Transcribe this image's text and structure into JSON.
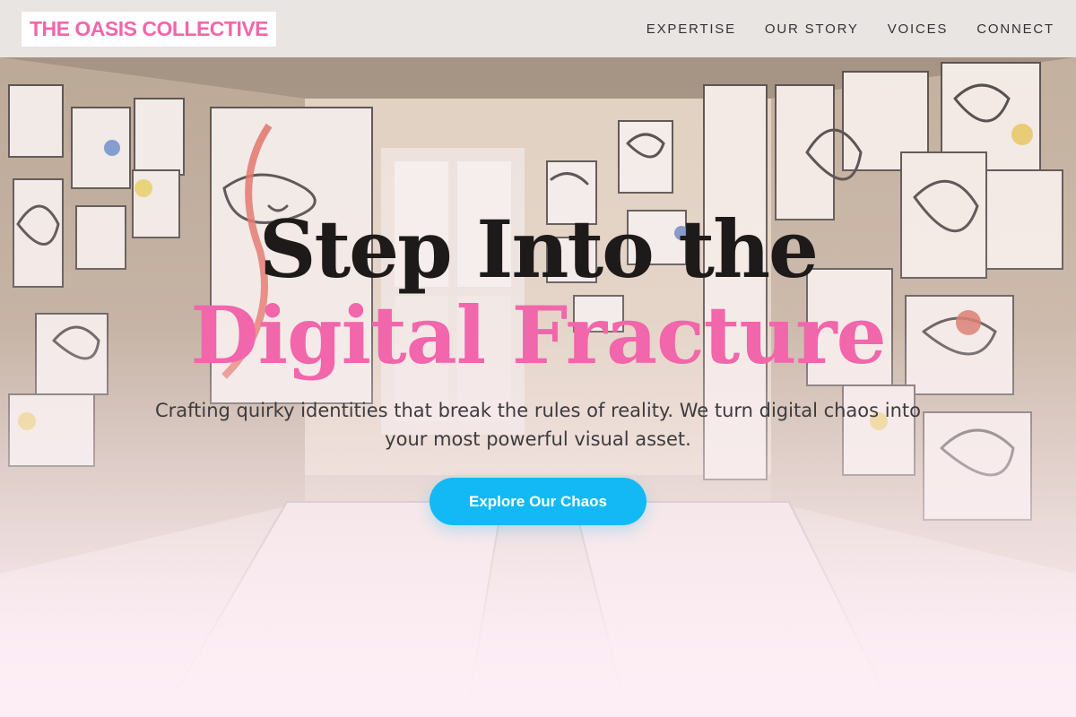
{
  "header": {
    "logo": "THE OASIS COLLECTIVE",
    "nav": [
      {
        "label": "EXPERTISE"
      },
      {
        "label": "OUR STORY"
      },
      {
        "label": "VOICES"
      },
      {
        "label": "CONNECT"
      }
    ]
  },
  "hero": {
    "headline_line1": "Step Into the",
    "headline_line2": "Digital Fracture",
    "subheading": "Crafting quirky identities that break the rules of reality. We turn digital chaos into your most powerful visual asset.",
    "cta_label": "Explore Our Chaos",
    "background_description_icon": "art-studio-photo"
  },
  "colors": {
    "accent_pink": "#f266ab",
    "cta_blue": "#13b9f4",
    "header_bg": "#ebe8e7"
  }
}
